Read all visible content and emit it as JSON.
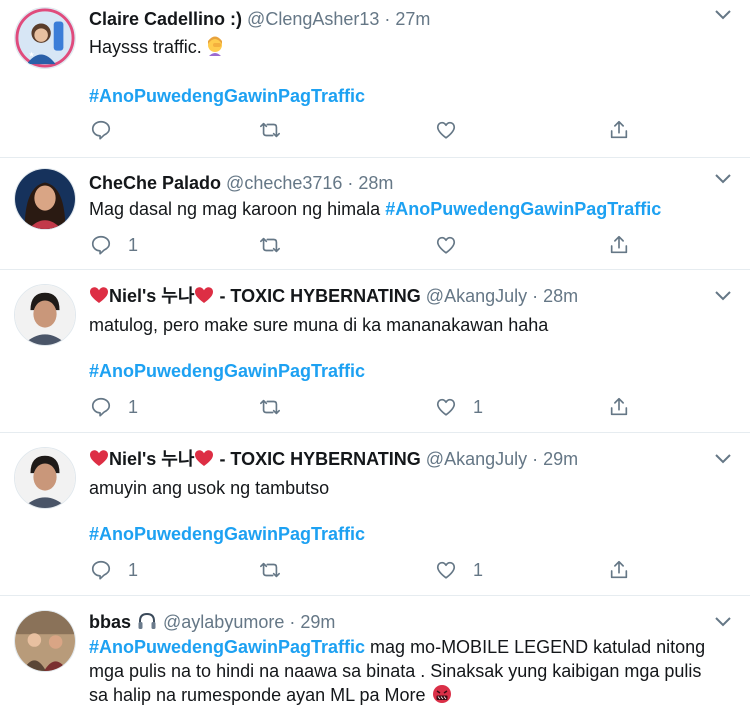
{
  "colors": {
    "text": "#14171a",
    "muted": "#657786",
    "link": "#1da1f2",
    "heart": "#e0245e",
    "divider": "#e6ecf0"
  },
  "tweets": [
    {
      "name": "Claire Cadellino :)",
      "handle": "@ClengAsher13",
      "time": "27m",
      "text": "Haysss traffic.",
      "hashtag": "#AnoPuwedengGawinPagTraffic",
      "reply_count": "",
      "like_count": ""
    },
    {
      "name": "CheChe Palado",
      "handle": "@cheche3716",
      "time": "28m",
      "text": "Mag dasal ng mag karoon ng himala ",
      "hashtag": "#AnoPuwedengGawinPagTraffic",
      "reply_count": "1",
      "like_count": ""
    },
    {
      "name_pre": "Niel's 누나",
      "name_post": " - TOXIC HYBERNATING",
      "handle": "@AkangJuly",
      "time": "28m",
      "text": "matulog, pero make sure muna di ka mananakawan haha",
      "hashtag": "#AnoPuwedengGawinPagTraffic",
      "reply_count": "1",
      "like_count": "1"
    },
    {
      "name_pre": "Niel's 누나",
      "name_post": " - TOXIC HYBERNATING",
      "handle": "@AkangJuly",
      "time": "29m",
      "text": "amuyin ang usok ng tambutso",
      "hashtag": "#AnoPuwedengGawinPagTraffic",
      "reply_count": "1",
      "like_count": "1"
    },
    {
      "name": "bbas",
      "handle": "@aylabyumore",
      "time": "29m",
      "hashtag": "#AnoPuwedengGawinPagTraffic",
      "text_line1": " mag mo-MOBILE LEGEND katulad nitong",
      "text_line2": "mga pulis na to hindi na naawa sa binata . Sinaksak yung kaibigan mga pulis",
      "text_line3": "sa halip na rumesponde ayan ML pa More"
    }
  ],
  "icons": {
    "reply": "reply-icon",
    "retweet": "retweet-icon",
    "like": "like-icon",
    "share": "share-icon",
    "caret": "chevron-down-icon",
    "heart_emoji": "red-heart-emoji",
    "facepalm_emoji": "woman-facepalming-emoji",
    "angry_emoji": "cursing-face-emoji",
    "headphone_emoji": "headphone-emoji"
  }
}
